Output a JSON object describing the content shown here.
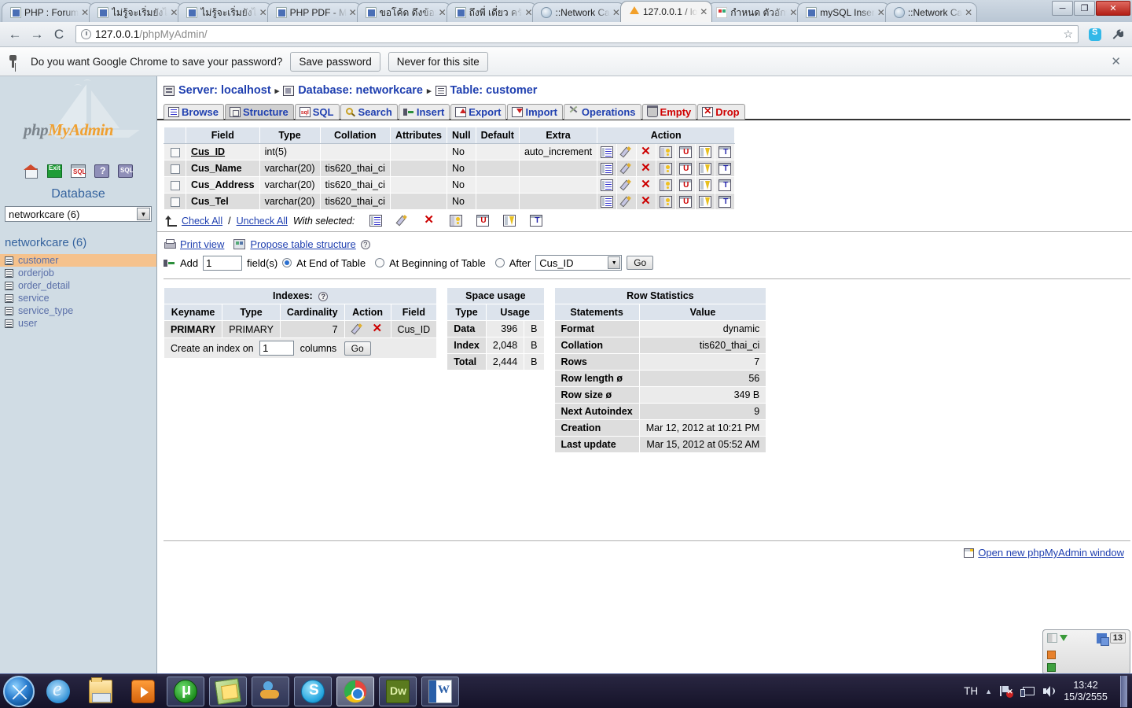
{
  "browser": {
    "tabs": [
      {
        "title": "PHP : Forum",
        "favicon": "php-file-icon",
        "active": false
      },
      {
        "title": "ไม่รู้จะเริ่มยังไ",
        "favicon": "php-file-icon",
        "active": false
      },
      {
        "title": "ไม่รู้จะเริ่มยังไ",
        "favicon": "php-file-icon",
        "active": false
      },
      {
        "title": "PHP PDF - M",
        "favicon": "php-file-icon",
        "active": false
      },
      {
        "title": "ขอโค้ด ดึงข้อมู",
        "favicon": "php-file-icon",
        "active": false
      },
      {
        "title": "ถึงพี่ เดี่ยว ครั",
        "favicon": "php-file-icon",
        "active": false
      },
      {
        "title": "::Network Ca",
        "favicon": "globe-icon",
        "active": false
      },
      {
        "title": "127.0.0.1 / lo",
        "favicon": "pma-icon",
        "active": true
      },
      {
        "title": "กำหนด ตัวอักษ",
        "favicon": "google-icon",
        "active": false
      },
      {
        "title": "mySQL Inser",
        "favicon": "php-file-icon",
        "active": false
      },
      {
        "title": "::Network Ca",
        "favicon": "globe-icon",
        "active": false
      }
    ],
    "tab_close_glyph": "✕",
    "window_buttons": {
      "minimize": "─",
      "maximize": "❐",
      "close": "✕"
    },
    "toolbar": {
      "back": "←",
      "forward": "→",
      "reload": "C",
      "url_host": "127.0.0.1",
      "url_path": "/phpMyAdmin/",
      "star": "☆",
      "wrench": "🔧"
    },
    "infobar": {
      "message": "Do you want Google Chrome to save your password?",
      "save_label": "Save password",
      "never_label": "Never for this site",
      "close_glyph": "✕"
    }
  },
  "sidebar": {
    "logo_gray": "php",
    "logo_orange": "MyAdmin",
    "icons": [
      "home-icon",
      "exit-icon",
      "sql-query-icon",
      "help-icon",
      "sql-help-icon"
    ],
    "database_heading": "Database",
    "database_select_value": "networkcare (6)",
    "database_label": "networkcare (6)",
    "tables": [
      {
        "name": "customer",
        "active": true
      },
      {
        "name": "orderjob",
        "active": false
      },
      {
        "name": "order_detail",
        "active": false
      },
      {
        "name": "service",
        "active": false
      },
      {
        "name": "service_type",
        "active": false
      },
      {
        "name": "user",
        "active": false
      }
    ]
  },
  "breadcrumb": {
    "server": "Server: localhost",
    "database": "Database: networkcare",
    "table": "Table: customer",
    "separator": "▸"
  },
  "tabs": [
    {
      "label": "Browse",
      "icon": "browse-icon",
      "active": false,
      "danger": false
    },
    {
      "label": "Structure",
      "icon": "structure-icon",
      "active": true,
      "danger": false
    },
    {
      "label": "SQL",
      "icon": "sql-icon",
      "active": false,
      "danger": false
    },
    {
      "label": "Search",
      "icon": "search-icon",
      "active": false,
      "danger": false
    },
    {
      "label": "Insert",
      "icon": "insert-icon",
      "active": false,
      "danger": false
    },
    {
      "label": "Export",
      "icon": "export-icon",
      "active": false,
      "danger": false
    },
    {
      "label": "Import",
      "icon": "import-icon",
      "active": false,
      "danger": false
    },
    {
      "label": "Operations",
      "icon": "operations-icon",
      "active": false,
      "danger": false
    },
    {
      "label": "Empty",
      "icon": "empty-icon",
      "active": false,
      "danger": true
    },
    {
      "label": "Drop",
      "icon": "drop-icon",
      "active": false,
      "danger": true
    }
  ],
  "structure": {
    "columns": [
      "",
      "Field",
      "Type",
      "Collation",
      "Attributes",
      "Null",
      "Default",
      "Extra",
      "Action"
    ],
    "rows": [
      {
        "field": "Cus_ID",
        "primary": true,
        "type": "int(5)",
        "collation": "",
        "attributes": "",
        "null": "No",
        "default": "",
        "extra": "auto_increment"
      },
      {
        "field": "Cus_Name",
        "primary": false,
        "type": "varchar(20)",
        "collation": "tis620_thai_ci",
        "attributes": "",
        "null": "No",
        "default": "",
        "extra": ""
      },
      {
        "field": "Cus_Address",
        "primary": false,
        "type": "varchar(20)",
        "collation": "tis620_thai_ci",
        "attributes": "",
        "null": "No",
        "default": "",
        "extra": ""
      },
      {
        "field": "Cus_Tel",
        "primary": false,
        "type": "varchar(20)",
        "collation": "tis620_thai_ci",
        "attributes": "",
        "null": "No",
        "default": "",
        "extra": ""
      }
    ],
    "row_action_icons": [
      "browse-icon",
      "edit-icon",
      "drop-icon",
      "primary-icon",
      "unique-icon",
      "index-icon",
      "fulltext-icon"
    ]
  },
  "with_selected": {
    "check_all": "Check All",
    "slash": "/",
    "uncheck_all": "Uncheck All",
    "label": "With selected:",
    "icons": [
      "browse-icon",
      "edit-icon",
      "drop-icon",
      "primary-icon",
      "unique-icon",
      "index-icon",
      "fulltext-icon"
    ]
  },
  "options": {
    "print_view": "Print view",
    "propose": "Propose table structure",
    "help_glyph": "?",
    "add_label": "Add",
    "add_count": "1",
    "fields_label": "field(s)",
    "at_end": "At End of Table",
    "at_beginning": "At Beginning of Table",
    "after": "After",
    "after_value": "Cus_ID",
    "go": "Go"
  },
  "indexes": {
    "title": "Indexes:",
    "help_glyph": "?",
    "columns": [
      "Keyname",
      "Type",
      "Cardinality",
      "Action",
      "Field"
    ],
    "rows": [
      {
        "keyname": "PRIMARY",
        "type": "PRIMARY",
        "cardinality": "7",
        "field": "Cus_ID"
      }
    ],
    "create_label": "Create an index on",
    "create_value": "1",
    "columns_label": "columns",
    "go": "Go"
  },
  "space_usage": {
    "title": "Space usage",
    "columns": [
      "Type",
      "Usage"
    ],
    "rows": [
      {
        "type": "Data",
        "usage": "396",
        "unit": "B"
      },
      {
        "type": "Index",
        "usage": "2,048",
        "unit": "B"
      },
      {
        "type": "Total",
        "usage": "2,444",
        "unit": "B"
      }
    ]
  },
  "row_statistics": {
    "title": "Row Statistics",
    "columns": [
      "Statements",
      "Value"
    ],
    "rows": [
      {
        "label": "Format",
        "value": "dynamic"
      },
      {
        "label": "Collation",
        "value": "tis620_thai_ci"
      },
      {
        "label": "Rows",
        "value": "7"
      },
      {
        "label": "Row length ø",
        "value": "56"
      },
      {
        "label": "Row size ø",
        "value": "349 B"
      },
      {
        "label": "Next Autoindex",
        "value": "9"
      },
      {
        "label": "Creation",
        "value": "Mar 12, 2012 at 10:21 PM"
      },
      {
        "label": "Last update",
        "value": "Mar 15, 2012 at 05:52 AM"
      }
    ]
  },
  "open_window_link": "Open new phpMyAdmin window",
  "widget": {
    "count_badge": "13"
  },
  "taskbar": {
    "start": "start-orb-icon",
    "items": [
      {
        "name": "internet-explorer",
        "glyph": "ie-icon",
        "state": "pinned"
      },
      {
        "name": "file-explorer",
        "glyph": "folder-icon",
        "state": "pinned"
      },
      {
        "name": "windows-media-player",
        "glyph": "wmp-icon",
        "state": "pinned"
      },
      {
        "name": "utorrent",
        "glyph": "utorrent-icon",
        "state": "running"
      },
      {
        "name": "notes",
        "glyph": "notes-icon",
        "state": "running"
      },
      {
        "name": "msn-messenger",
        "glyph": "msn-icon",
        "state": "running"
      },
      {
        "name": "skype",
        "glyph": "skype-icon",
        "state": "running"
      },
      {
        "name": "google-chrome",
        "glyph": "chrome-icon",
        "state": "active-win"
      },
      {
        "name": "dreamweaver",
        "glyph": "dw-icon",
        "state": "running"
      },
      {
        "name": "microsoft-word",
        "glyph": "word-icon",
        "state": "running"
      }
    ],
    "tray": {
      "language": "TH",
      "caret": "▲",
      "icons": [
        "network-error-icon",
        "monitor-icon",
        "volume-icon"
      ],
      "time": "13:42",
      "date": "15/3/2555"
    }
  }
}
